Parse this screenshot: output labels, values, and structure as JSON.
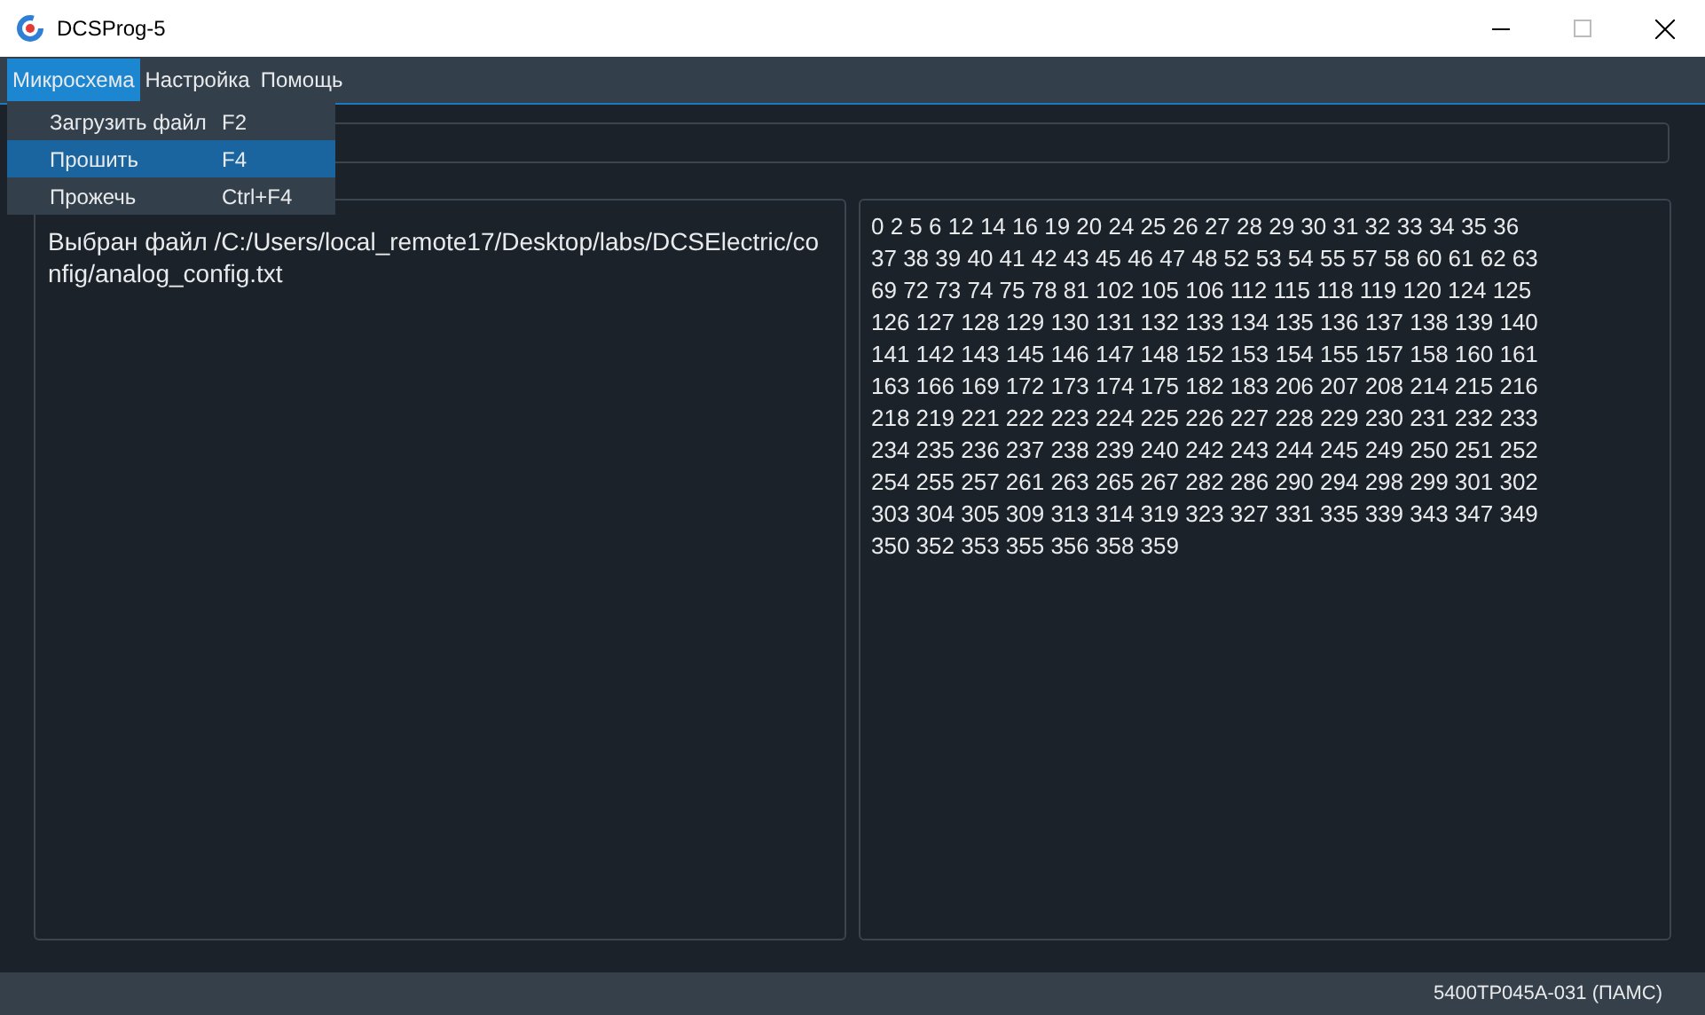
{
  "window": {
    "title": "DCSProg-5"
  },
  "menu_bar": [
    {
      "label": "Микросхема",
      "selected": true
    },
    {
      "label": "Настройка",
      "selected": false
    },
    {
      "label": "Помощь",
      "selected": false
    }
  ],
  "dropdown": [
    {
      "label": "Загрузить файл",
      "shortcut": "F2",
      "selected": false
    },
    {
      "label": "Прошить",
      "shortcut": "F4",
      "selected": true
    },
    {
      "label": "Прожечь",
      "shortcut": "Ctrl+F4",
      "selected": false
    }
  ],
  "left_panel": {
    "text": "Выбран файл /C:/Users/local_remote17/Desktop/labs/DCSElectric/config/analog_config.txt"
  },
  "right_panel": {
    "lines": [
      "0 2 5 6 12 14 16 19 20 24 25 26 27 28 29 30 31 32 33 34 35 36",
      "37 38 39 40 41 42 43 45 46 47 48 52 53 54 55 57 58 60 61 62 63",
      "69 72 73 74 75 78 81 102 105 106 112 115 118 119 120 124 125",
      "126 127 128 129 130 131 132 133 134 135 136 137 138 139 140",
      "141 142 143 145 146 147 148 152 153 154 155 157 158 160 161",
      "163 166 169 172 173 174 175 182 183 206 207 208 214 215 216",
      "218 219 221 222 223 224 225 226 227 228 229 230 231 232 233",
      "234 235 236 237 238 239 240 242 243 244 245 249 250 251 252",
      "254 255 257 261 263 265 267 282 286 290 294 298 299 301 302",
      "303 304 305 309 313 314 319 323 327 331 335 339 343 347 349",
      "350 352 353 355 356 358 359"
    ]
  },
  "status_bar": {
    "text": "5400TP045A-031 (ПАМС)"
  }
}
